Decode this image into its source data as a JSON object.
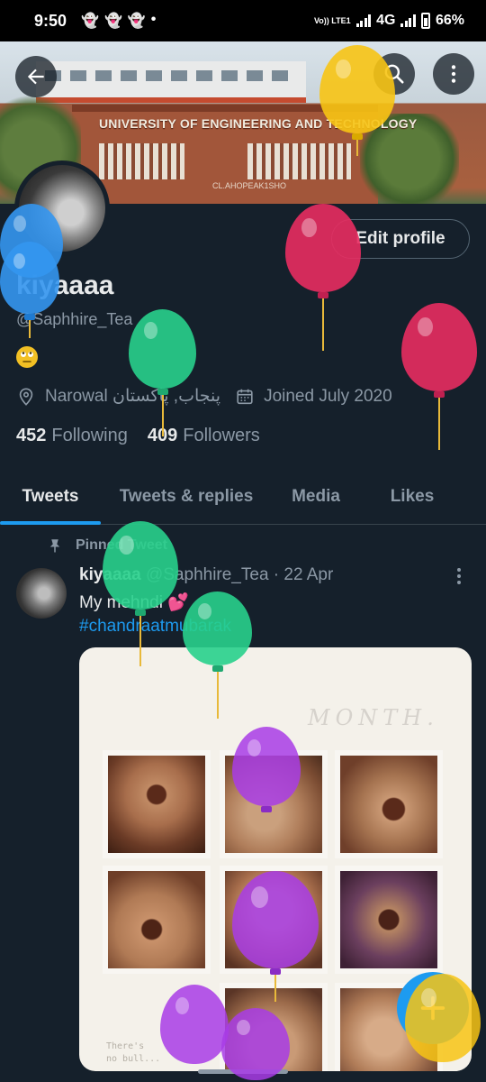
{
  "status_bar": {
    "time": "9:50",
    "notification_icons": [
      "snapchat-icon",
      "snapchat-icon",
      "snapchat-icon",
      "dot-icon"
    ],
    "volte": "Vo)) LTE1",
    "network": "4G",
    "battery": "66%"
  },
  "banner": {
    "title": "UNIVERSITY OF ENGINEERING AND TECHNOLOGY",
    "watermark": "CL.AHOPEAK1SHO"
  },
  "profile": {
    "edit_label": "Edit profile",
    "display_name": "kiyaaaa",
    "handle": "@Saphhire_Tea",
    "bio_emoji": "🙄",
    "location": "Narowal پنجاب, پاکستان",
    "joined": "Joined July 2020",
    "following_count": "452",
    "following_label": "Following",
    "followers_count": "409",
    "followers_label": "Followers"
  },
  "tabs": [
    {
      "label": "Tweets",
      "active": true
    },
    {
      "label": "Tweets & replies",
      "active": false
    },
    {
      "label": "Media",
      "active": false
    },
    {
      "label": "Likes",
      "active": false
    }
  ],
  "tweet": {
    "pinned_label": "Pinned Tweet",
    "name": "kiyaaaa",
    "meta": "@Saphhire_Tea · 22 Apr",
    "text": "My mehndi 💕",
    "hashtag": "#chandraatmubarak",
    "media_title": "MONTH.",
    "media_note": "There's\nno bull..."
  },
  "fab": {
    "icon": "plus-icon",
    "color": "#1d9bf0"
  },
  "colors": {
    "background": "#15202b",
    "accent": "#1d9bf0",
    "muted": "#8b98a5",
    "text": "#e7e9ea"
  }
}
